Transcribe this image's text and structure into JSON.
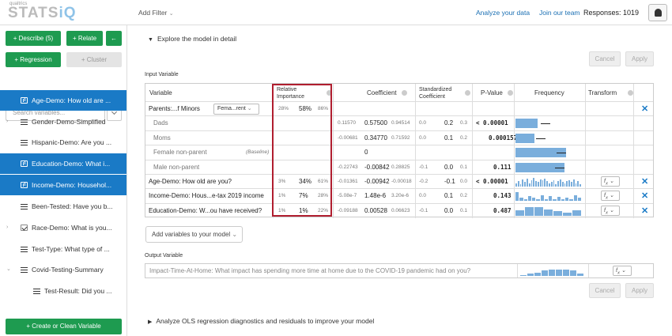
{
  "header": {
    "logo_small": "qualtrics",
    "logo_main": "STATS",
    "logo_iq": "iQ",
    "add_filter": "Add Filter",
    "analyze_link": "Analyze your data",
    "join_link": "Join our team",
    "responses": "Responses: 1019"
  },
  "sidebar": {
    "describe_btn": "Describe (5)",
    "relate_btn": "Relate",
    "back_btn": "←",
    "regression_btn": "Regression",
    "cluster_btn": "Cluster",
    "search_placeholder": "Search variables...",
    "items": [
      {
        "label": "Age-Demo: How old are ...",
        "selected": true,
        "icon": "bar-chart-icon"
      },
      {
        "label": "Gender-Demo-Simplified",
        "selected": false,
        "icon": "list-icon"
      },
      {
        "label": "Hispanic-Demo: Are you ...",
        "selected": false,
        "icon": "list-icon"
      },
      {
        "label": "Education-Demo: What i...",
        "selected": true,
        "icon": "bar-chart-icon"
      },
      {
        "label": "Income-Demo: Househol...",
        "selected": true,
        "icon": "bar-chart-icon"
      },
      {
        "label": "Been-Tested: Have you b...",
        "selected": false,
        "icon": "list-icon"
      },
      {
        "label": "Race-Demo: What is you...",
        "selected": false,
        "icon": "checkbox-icon"
      },
      {
        "label": "Test-Type: What type of ...",
        "selected": false,
        "icon": "list-icon"
      },
      {
        "label": "Covid-Testing-Summary",
        "selected": false,
        "icon": "list-icon"
      },
      {
        "label": "Test-Result: Did you ...",
        "selected": false,
        "icon": "list-icon"
      }
    ],
    "create_btn": "Create or Clean Variable"
  },
  "main": {
    "explore_toggle": "Explore the model in detail",
    "cancel_label": "Cancel",
    "apply_label": "Apply",
    "input_variable_label": "Input Variable",
    "output_variable_label": "Output Variable",
    "add_vars_btn": "Add variables to your model",
    "diagnostics_toggle": "Analyze OLS regression diagnostics and residuals to improve your model",
    "columns": {
      "variable": "Variable",
      "rel_importance": "Relative Importance",
      "coefficient": "Coefficient",
      "std_coefficient": "Standardized Coefficient",
      "p_value": "P-Value",
      "frequency": "Frequency",
      "transform": "Transform"
    },
    "rows": [
      {
        "variable": "Parents:...f Minors",
        "select": "Fema...rent",
        "ri_low": "28%",
        "ri": "58%",
        "ri_high": "86%",
        "c_low": "",
        "coef": "",
        "c_high": "",
        "s_low": "",
        "std": "",
        "s_high": "",
        "p": "",
        "fx": ""
      },
      {
        "variable": "Dads",
        "ri_low": "",
        "ri": "",
        "ri_high": "",
        "c_low": "0.11570",
        "coef": "0.57500",
        "c_high": "0.94514",
        "s_low": "0.0",
        "std": "0.2",
        "s_high": "0.3",
        "p": "< 0.00001",
        "fx": ""
      },
      {
        "variable": "Moms",
        "ri_low": "",
        "ri": "",
        "ri_high": "",
        "c_low": "-0.00681",
        "coef": "0.34770",
        "c_high": "0.71592",
        "s_low": "0.0",
        "std": "0.1",
        "s_high": "0.2",
        "p": "0.000157",
        "fx": ""
      },
      {
        "variable": "Female non-parent",
        "baseline": "(Baseline)",
        "ri_low": "",
        "ri": "",
        "ri_high": "",
        "c_low": "",
        "coef": "0",
        "c_high": "",
        "s_low": "",
        "std": "",
        "s_high": "",
        "p": "",
        "fx": ""
      },
      {
        "variable": "Male non-parent",
        "ri_low": "",
        "ri": "",
        "ri_high": "",
        "c_low": "-0.22743",
        "coef": "-0.00842",
        "c_high": "0.28825",
        "s_low": "-0.1",
        "std": "0.0",
        "s_high": "0.1",
        "p": "0.111",
        "fx": ""
      },
      {
        "variable": "Age-Demo: How old are you?",
        "ri_low": "3%",
        "ri": "34%",
        "ri_high": "61%",
        "c_low": "-0.01361",
        "coef": "-0.00942",
        "c_high": "-0.00018",
        "s_low": "-0.2",
        "std": "-0.1",
        "s_high": "0.0",
        "p": "< 0.00001",
        "fx": "f"
      },
      {
        "variable": "Income-Demo: Hous...e-tax 2019 income",
        "ri_low": "1%",
        "ri": "7%",
        "ri_high": "28%",
        "c_low": "-5.08e-7",
        "coef": "1.48e-6",
        "c_high": "3.20e-6",
        "s_low": "0.0",
        "std": "0.1",
        "s_high": "0.2",
        "p": "0.143",
        "fx": "f"
      },
      {
        "variable": "Education-Demo: W...ou have received?",
        "ri_low": "1%",
        "ri": "1%",
        "ri_high": "22%",
        "c_low": "-0.09188",
        "coef": "0.00528",
        "c_high": "0.06623",
        "s_low": "-0.1",
        "std": "0.0",
        "s_high": "0.1",
        "p": "0.487",
        "fx": "f"
      }
    ],
    "output_variable": "Impact-Time-At-Home: What impact has spending more time at home due to the COVID-19 pandemic had on you?",
    "output_fx": "f"
  }
}
